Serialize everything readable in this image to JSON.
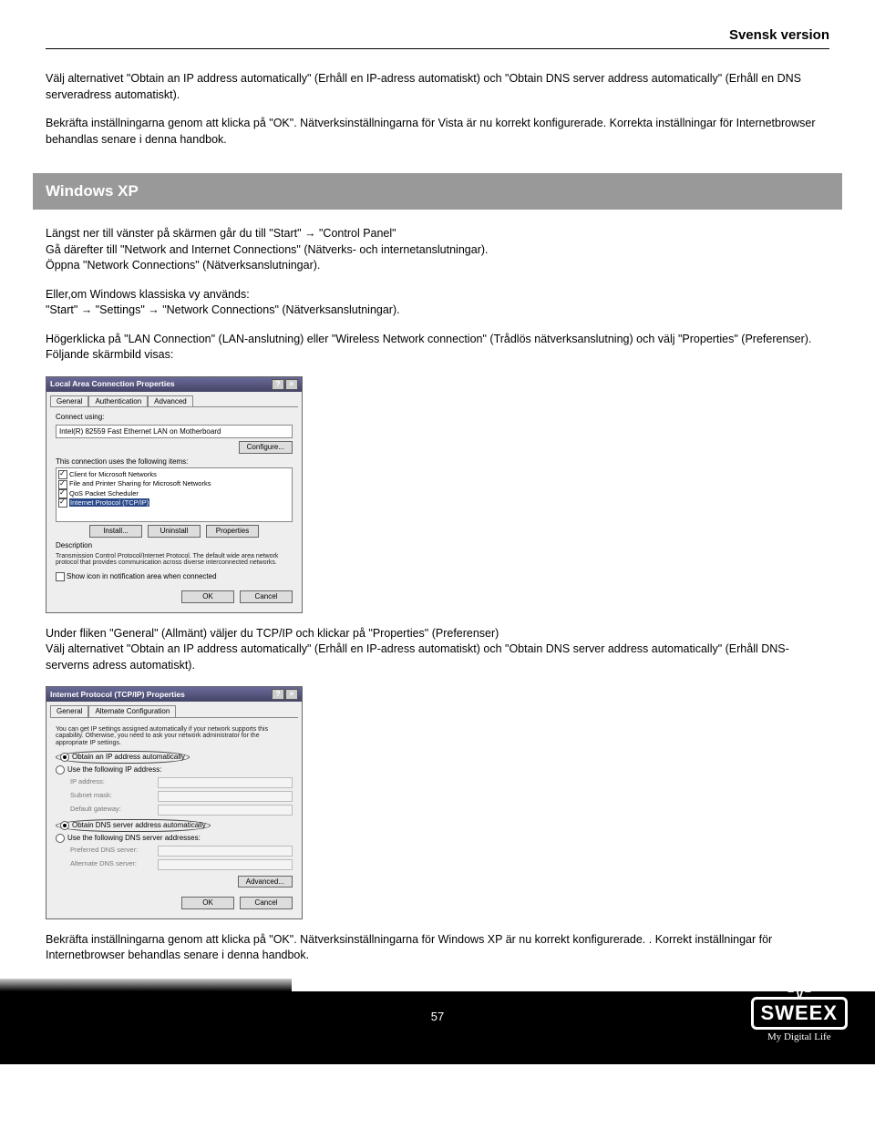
{
  "header": {
    "title": "Svensk version"
  },
  "intro": {
    "p1": "Välj alternativet \"Obtain an IP address automatically\" (Erhåll en IP-adress automatiskt) och \"Obtain DNS server address automatically\" (Erhåll en DNS serveradress automatiskt).",
    "p2": "Bekräfta inställningarna genom att klicka på \"OK\". Nätverksinställningarna för Vista är nu korrekt konfigurerade. Korrekta inställningar för Internetbrowser behandlas senare i denna handbok."
  },
  "section": {
    "title": "Windows XP"
  },
  "xp": {
    "p1a": "Längst ner till vänster på skärmen går du till \"Start\" ",
    "arrow": "→",
    "p1b": " \"Control Panel\"",
    "p2": "Gå därefter till \"Network and Internet Connections\" (Nätverks- och internetanslutningar).",
    "p3": "Öppna \"Network Connections\" (Nätverksanslutningar).",
    "p4": "Eller,om Windows klassiska vy används:",
    "p5a": "\"Start\" ",
    "p5b": " \"Settings\" ",
    "p5c": " \"Network Connections\" (Nätverksanslutningar).",
    "p6": "Högerklicka på \"LAN Connection\" (LAN-anslutning) eller \"Wireless Network connection\" (Trådlös nätverksanslutning) och välj \"Properties\" (Preferenser). Följande skärmbild visas:"
  },
  "dialog1": {
    "title": "Local Area Connection Properties",
    "tabs": {
      "general": "General",
      "auth": "Authentication",
      "adv": "Advanced"
    },
    "connectLabel": "Connect using:",
    "adapter": "Intel(R) 82559 Fast Ethernet LAN on Motherboard",
    "configureBtn": "Configure...",
    "itemsLabel": "This connection uses the following items:",
    "items": {
      "i1": "Client for Microsoft Networks",
      "i2": "File and Printer Sharing for Microsoft Networks",
      "i3": "QoS Packet Scheduler",
      "i4": "Internet Protocol (TCP/IP)"
    },
    "install": "Install...",
    "uninstall": "Uninstall",
    "properties": "Properties",
    "descLabel": "Description",
    "desc": "Transmission Control Protocol/Internet Protocol. The default wide area network protocol that provides communication across diverse interconnected networks.",
    "showIcon": "Show icon in notification area when connected",
    "ok": "OK",
    "cancel": "Cancel"
  },
  "mid": {
    "p1": "Under fliken \"General\" (Allmänt) väljer du TCP/IP och klickar på \"Properties\" (Preferenser)",
    "p2": "Välj alternativet \"Obtain an IP address automatically\" (Erhåll en IP-adress automatiskt) och \"Obtain DNS server address automatically\" (Erhåll DNS-serverns adress automatiskt)."
  },
  "dialog2": {
    "title": "Internet Protocol (TCP/IP) Properties",
    "tabs": {
      "general": "General",
      "alt": "Alternate Configuration"
    },
    "desc": "You can get IP settings assigned automatically if your network supports this capability. Otherwise, you need to ask your network administrator for the appropriate IP settings.",
    "r1": "Obtain an IP address automatically",
    "r2": "Use the following IP address:",
    "ip": "IP address:",
    "mask": "Subnet mask:",
    "gw": "Default gateway:",
    "r3": "Obtain DNS server address automatically",
    "r4": "Use the following DNS server addresses:",
    "pdns": "Preferred DNS server:",
    "adns": "Alternate DNS server:",
    "advanced": "Advanced...",
    "ok": "OK",
    "cancel": "Cancel"
  },
  "final": {
    "p1": "Bekräfta inställningarna genom att klicka på \"OK\". Nätverksinställningarna för Windows XP är nu korrekt konfigurerade. . Korrekt inställningar för Internetbrowser behandlas senare i denna handbok."
  },
  "footer": {
    "page": "57",
    "brand": "SWEEX",
    "tagline": "My Digital Life"
  }
}
